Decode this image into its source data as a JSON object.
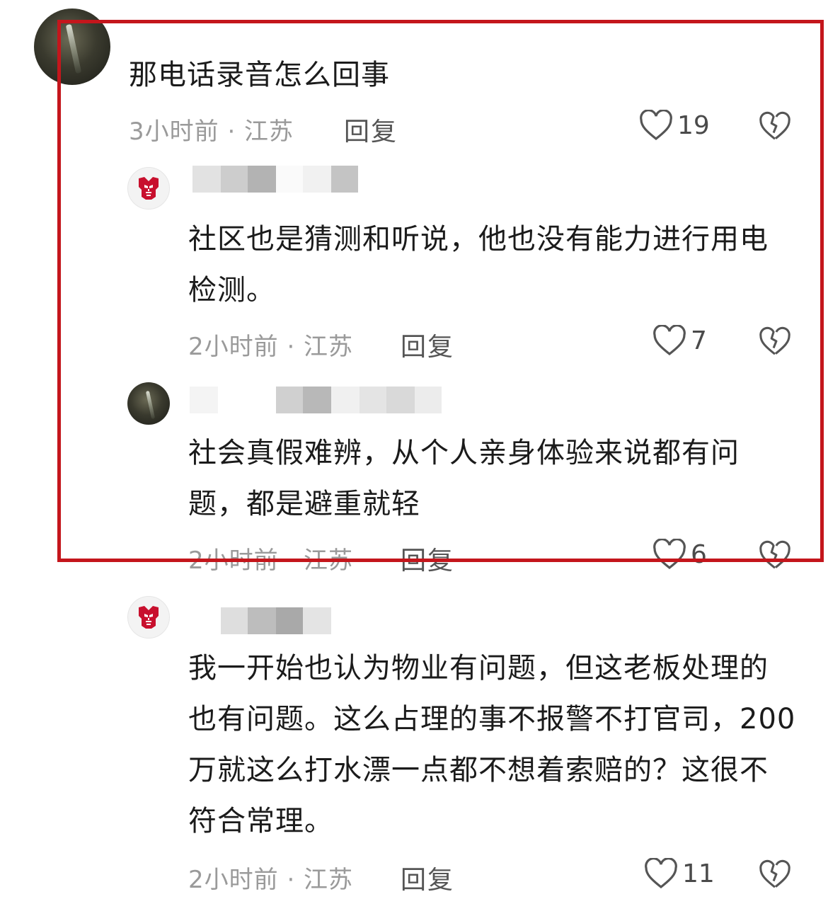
{
  "comments": [
    {
      "text": "那电话录音怎么回事",
      "time_location": "3小时前 · 江苏",
      "reply_label": "回复",
      "likes": "19",
      "avatar_icon": "night-photo-avatar"
    },
    {
      "text": "社区也是猜测和听说，他也没有能力进行用电检测。",
      "time_location": "2小时前 · 江苏",
      "reply_label": "回复",
      "likes": "7",
      "avatar_icon": "transformers-logo-avatar"
    },
    {
      "text": "社会真假难辨，从个人亲身体验来说都有问题，都是避重就轻",
      "time_location": "2小时前 · 江苏",
      "reply_label": "回复",
      "likes": "6",
      "avatar_icon": "night-photo-avatar"
    },
    {
      "text": "我一开始也认为物业有问题，但这老板处理的也有问题。这么占理的事不报警不打官司，200万就这么打水漂一点都不想着索赔的？这很不符合常理。",
      "time_location": "2小时前 · 江苏",
      "reply_label": "回复",
      "likes": "11",
      "avatar_icon": "transformers-logo-avatar"
    }
  ],
  "colors": {
    "highlight_border": "#c4161c",
    "logo_red": "#c8102e",
    "meta_gray": "#9a9a9a"
  }
}
